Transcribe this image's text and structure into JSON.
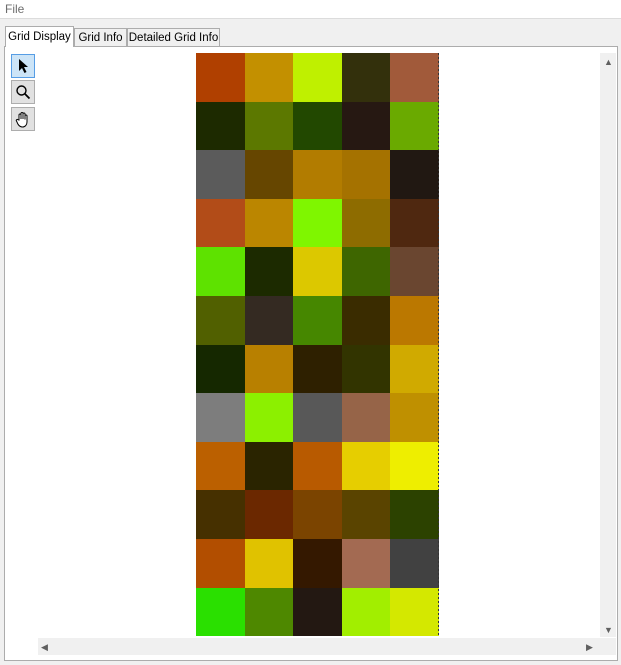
{
  "menu": {
    "file_label": "File"
  },
  "tabs": [
    {
      "label": "Grid Display",
      "active": true
    },
    {
      "label": "Grid Info",
      "active": false
    },
    {
      "label": "Detailed Grid Info",
      "active": false
    }
  ],
  "tools": [
    {
      "name": "pointer-tool",
      "icon": "arrow-pointer-icon",
      "selected": true
    },
    {
      "name": "zoom-tool",
      "icon": "magnifier-icon",
      "selected": false
    },
    {
      "name": "pan-tool",
      "icon": "hand-icon",
      "selected": false
    }
  ],
  "grid": {
    "columns": 5,
    "rows": 12,
    "colors": [
      [
        "#b04000",
        "#c39000",
        "#bff000",
        "#33300c",
        "#a15a3a"
      ],
      [
        "#1d2a00",
        "#5c7800",
        "#224800",
        "#261812",
        "#6aaa00"
      ],
      [
        "#5b5b5b",
        "#664600",
        "#b27c00",
        "#a57200",
        "#211812"
      ],
      [
        "#b24c18",
        "#bb8600",
        "#7ff600",
        "#8e6c00",
        "#4f2810"
      ],
      [
        "#5ee200",
        "#1c2a00",
        "#dcc800",
        "#3e6600",
        "#6a4630"
      ],
      [
        "#516000",
        "#342a22",
        "#468700",
        "#3a2c00",
        "#bb7800"
      ],
      [
        "#152800",
        "#b88000",
        "#2e2000",
        "#323400",
        "#d0aa00"
      ],
      [
        "#7d7d7d",
        "#8cf000",
        "#585858",
        "#966448",
        "#bf9000"
      ],
      [
        "#bb6000",
        "#2a2400",
        "#b85a00",
        "#e6ce00",
        "#eeee00"
      ],
      [
        "#463000",
        "#6b2800",
        "#7b4400",
        "#5a4400",
        "#2c4200"
      ],
      [
        "#b24e00",
        "#e0c200",
        "#341800",
        "#a36a52",
        "#414141"
      ],
      [
        "#2ae000",
        "#4e8800",
        "#231812",
        "#a2ee00",
        "#d4e800"
      ]
    ]
  }
}
